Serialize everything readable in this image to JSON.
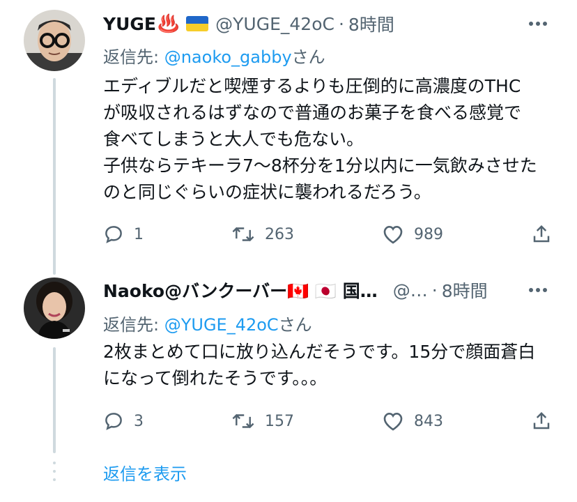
{
  "tweets": [
    {
      "name": "YUGE",
      "name_emoji": "♨️",
      "flag_emoji": "🇺🇦",
      "handle": "@YUGE_42oC",
      "dot": "·",
      "time": "8時間",
      "reply_prefix": "返信先: ",
      "reply_mention": "@naoko_gabby",
      "reply_suffix": "さん",
      "text": "エディブルだと喫煙するよりも圧倒的に高濃度のTHC\nが吸収されるはずなので普通のお菓子を食べる感覚で\n食べてしまうと大人でも危ない。\n子供ならテキーラ7〜8杯分を1分以内に一気飲みさせた\nのと同じぐらいの症状に襲われるだろう。",
      "reply_count": "1",
      "retweet_count": "263",
      "like_count": "989"
    },
    {
      "name": "Naoko@バンクーバー🇨🇦 🇯🇵 国…",
      "handle": "@…",
      "dot": "·",
      "time": "8時間",
      "reply_prefix": "返信先: ",
      "reply_mention": "@YUGE_42oC",
      "reply_suffix": "さん",
      "text": "2枚まとめて口に放り込んだそうです。15分で顔面蒼白\nになって倒れたそうです。。。",
      "reply_count": "3",
      "retweet_count": "157",
      "like_count": "843"
    }
  ],
  "show_replies": "返信を表示",
  "colors": {
    "text": "#0f1419",
    "secondary": "#536471",
    "link": "#1d9bf0",
    "thread": "#cfd9de"
  }
}
